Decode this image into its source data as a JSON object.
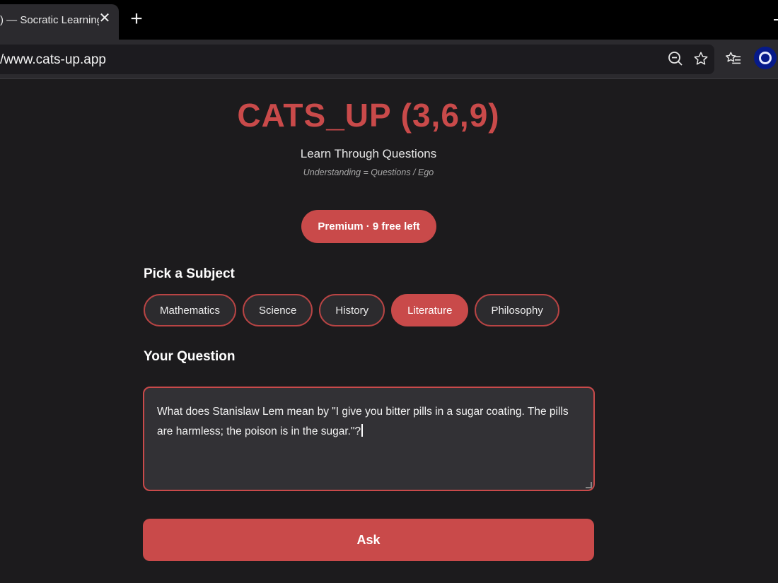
{
  "browser": {
    "tab_title": ") — Socratic Learning",
    "tab_close": "✕",
    "new_tab": "+",
    "url": "/www.cats-up.app",
    "toolbar_icons": [
      "zoom-out-icon",
      "star-icon",
      "favorites-list-icon",
      "profile-avatar"
    ]
  },
  "header": {
    "title": "CATS_UP (3,6,9)",
    "subtitle": "Learn Through Questions",
    "tagline": "Understanding = Questions / Ego"
  },
  "premium": {
    "label": "Premium · 9 free left"
  },
  "subjects": {
    "heading": "Pick a Subject",
    "items": [
      {
        "label": "Mathematics",
        "selected": false
      },
      {
        "label": "Science",
        "selected": false
      },
      {
        "label": "History",
        "selected": false
      },
      {
        "label": "Literature",
        "selected": true
      },
      {
        "label": "Philosophy",
        "selected": false
      }
    ]
  },
  "question": {
    "heading": "Your Question",
    "value": "What does Stanislaw Lem mean by \"I give you bitter pills in a sugar coating.  The pills are harmless; the poison is in the sugar.\"?"
  },
  "actions": {
    "ask_label": "Ask"
  },
  "colors": {
    "accent": "#c94a4a",
    "background": "#1c1b1d",
    "chip_background": "#2c2b2e"
  }
}
